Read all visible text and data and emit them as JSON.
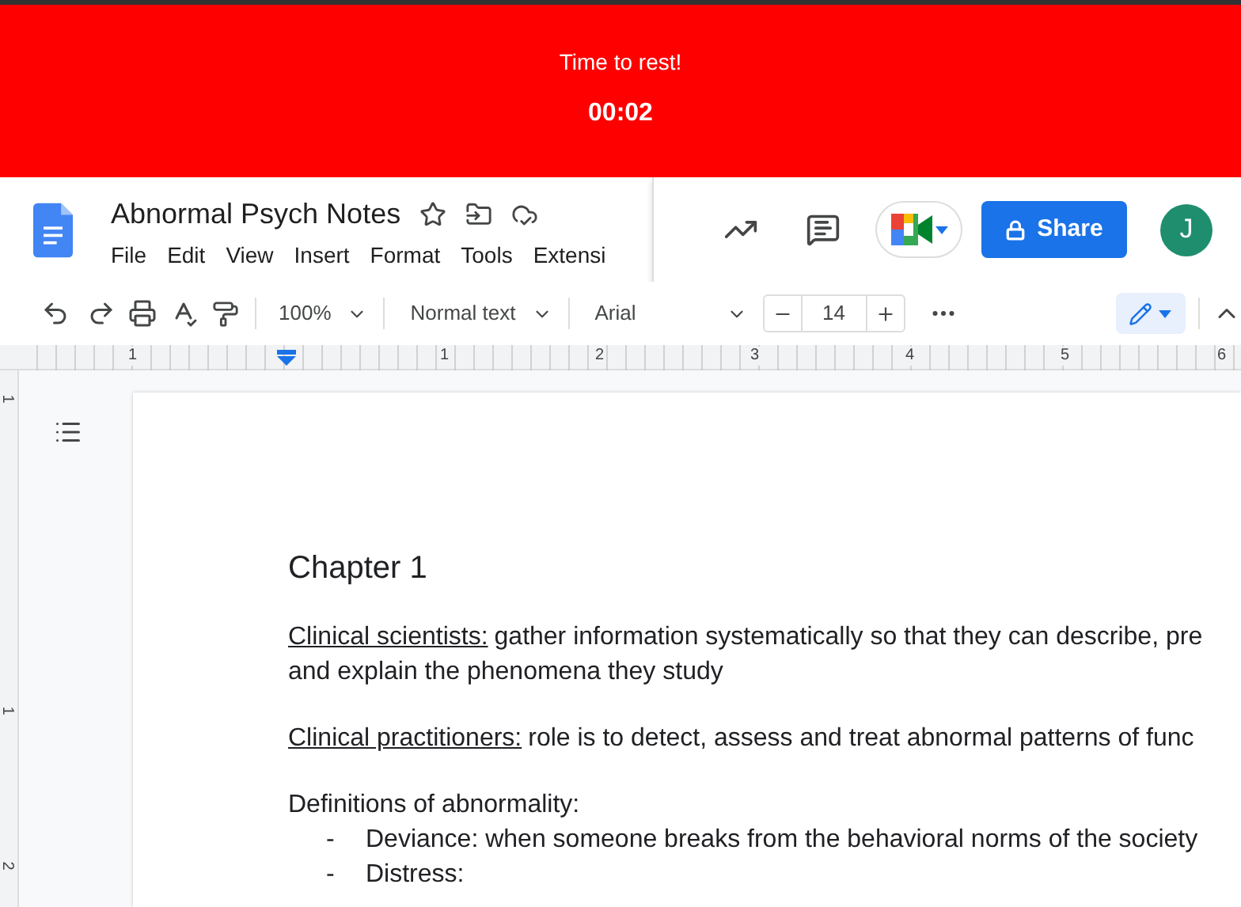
{
  "timer_banner": {
    "message": "Time to rest!",
    "time": "00:02"
  },
  "document": {
    "title": "Abnormal Psych Notes",
    "menu": [
      "File",
      "Edit",
      "View",
      "Insert",
      "Format",
      "Tools",
      "Extensi"
    ]
  },
  "header_actions": {
    "share_label": "Share",
    "avatar_initial": "J"
  },
  "toolbar": {
    "zoom": "100%",
    "style": "Normal text",
    "font": "Arial",
    "font_size": "14"
  },
  "horizontal_ruler": [
    "1",
    "1",
    "2",
    "3",
    "4",
    "5",
    "6"
  ],
  "vertical_ruler": [
    "1",
    "1",
    "2"
  ],
  "content": [
    {
      "kind": "heading",
      "text": "Chapter 1"
    },
    {
      "kind": "term",
      "term": "Clinical scientists:",
      "lines": [
        "gather information systematically so that they can describe, pre",
        "and explain the phenomena they study"
      ]
    },
    {
      "kind": "term",
      "term": "Clinical practitioners:",
      "lines": [
        "role is to detect, assess and treat abnormal patterns of func"
      ]
    },
    {
      "kind": "text",
      "text": "Definitions of abnormality:"
    },
    {
      "kind": "bullet",
      "marker": "-",
      "text": "Deviance: when someone breaks from the behavioral norms of the society"
    },
    {
      "kind": "bullet",
      "marker": "-",
      "text": "Distress:"
    }
  ]
}
